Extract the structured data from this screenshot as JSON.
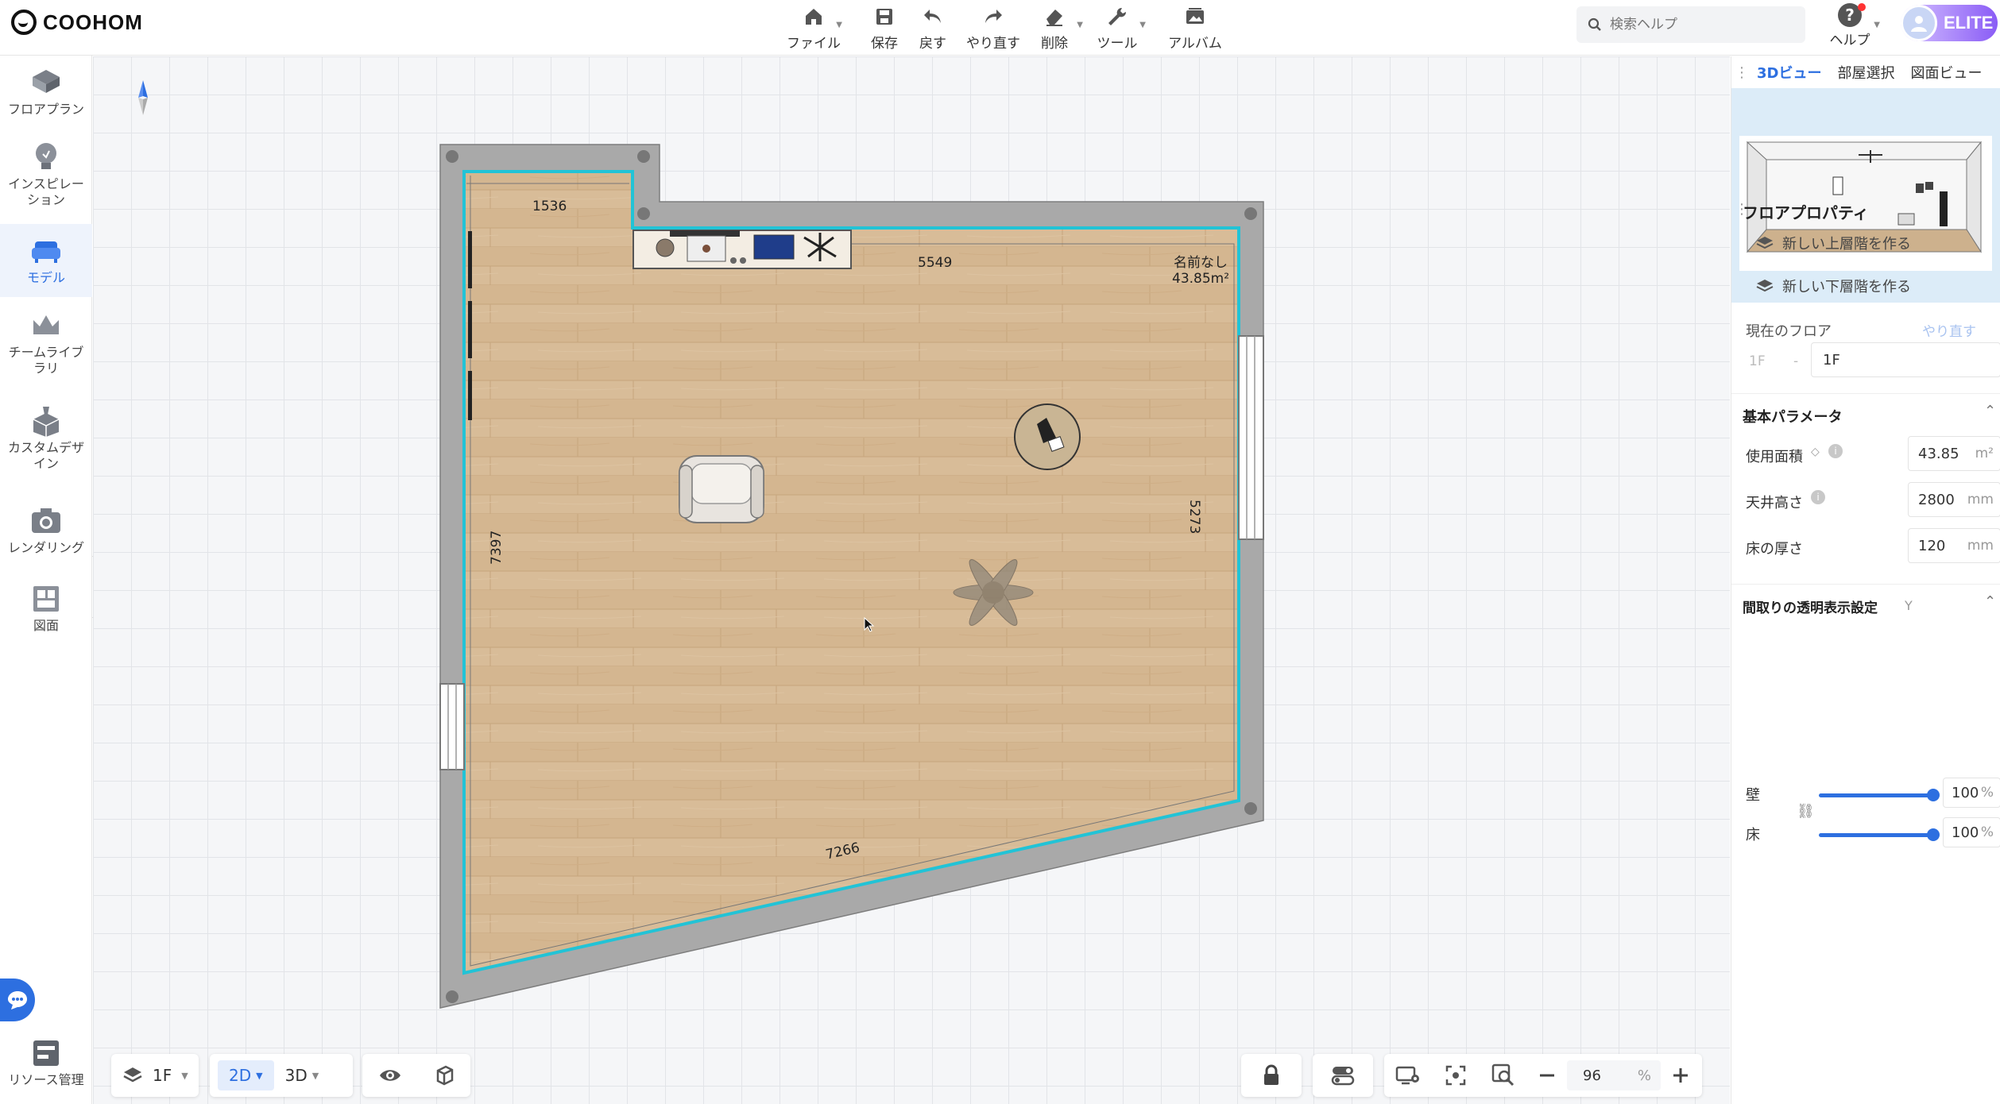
{
  "app": {
    "logo": "COOHOM"
  },
  "toolbar": {
    "file": "ファイル",
    "save": "保存",
    "undo": "戻す",
    "redo": "やり直す",
    "delete": "削除",
    "tools": "ツール",
    "album": "アルバム"
  },
  "search": {
    "placeholder": "検索ヘルプ"
  },
  "help": {
    "label": "ヘルプ"
  },
  "user": {
    "badge": "ELITE"
  },
  "sidebar": {
    "items": [
      {
        "label": "フロアプラン"
      },
      {
        "label": "インスピレー\nション"
      },
      {
        "label": "モデル"
      },
      {
        "label": "チームライブ\nラリ"
      },
      {
        "label": "カスタムデザ\nイン"
      },
      {
        "label": "レンダリング"
      },
      {
        "label": "図面"
      },
      {
        "label": "リソース管理"
      }
    ]
  },
  "plan": {
    "room_name": "名前なし",
    "room_area": "43.85m²",
    "dims": {
      "top_left": "1536",
      "top": "5549",
      "left": "7397",
      "right": "5273",
      "bottom": "7266"
    }
  },
  "bottom": {
    "floor": "1F",
    "view2d": "2D",
    "view3d": "3D",
    "zoom_value": "96",
    "zoom_unit": "%"
  },
  "right": {
    "tabs": [
      "3Dビュー",
      "部屋選択",
      "図面ビュー"
    ],
    "floor_props_title": "フロアプロパティ",
    "new_upper": "新しい上層階を作る",
    "new_lower": "新しい下層階を作る",
    "current_floor_label": "現在のフロア",
    "redo_link": "やり直す",
    "floor_select_left": "1F",
    "floor_select_value": "1F",
    "basic_params_title": "基本パラメータ",
    "area_label": "使用面積",
    "area_value": "43.85",
    "area_unit": "m²",
    "ceiling_label": "天井高さ",
    "ceiling_value": "2800",
    "ceiling_unit": "mm",
    "floor_thickness_label": "床の厚さ",
    "floor_thickness_value": "120",
    "floor_thickness_unit": "mm",
    "transparency_title": "間取りの透明表示設定",
    "transparency_key": "Y",
    "wall_label": "壁",
    "wall_value": "100",
    "floor_label": "床",
    "floor_value": "100",
    "percent": "%",
    "wall_opacity": 1.0,
    "floor_opacity": 1.0
  },
  "colors": {
    "accent": "#2d6fe0",
    "room_outline": "#22c3d6",
    "wall": "#a9a9a9"
  }
}
